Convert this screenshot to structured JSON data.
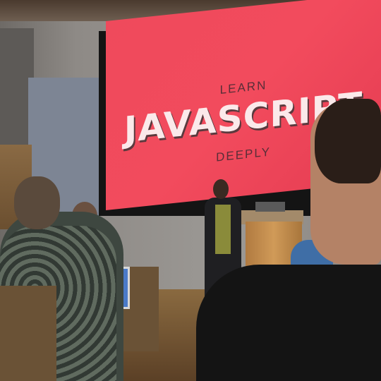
{
  "screen": {
    "line1": "LEARN",
    "line2": "JAVASCRIPT",
    "line3": "DEEPLY"
  }
}
